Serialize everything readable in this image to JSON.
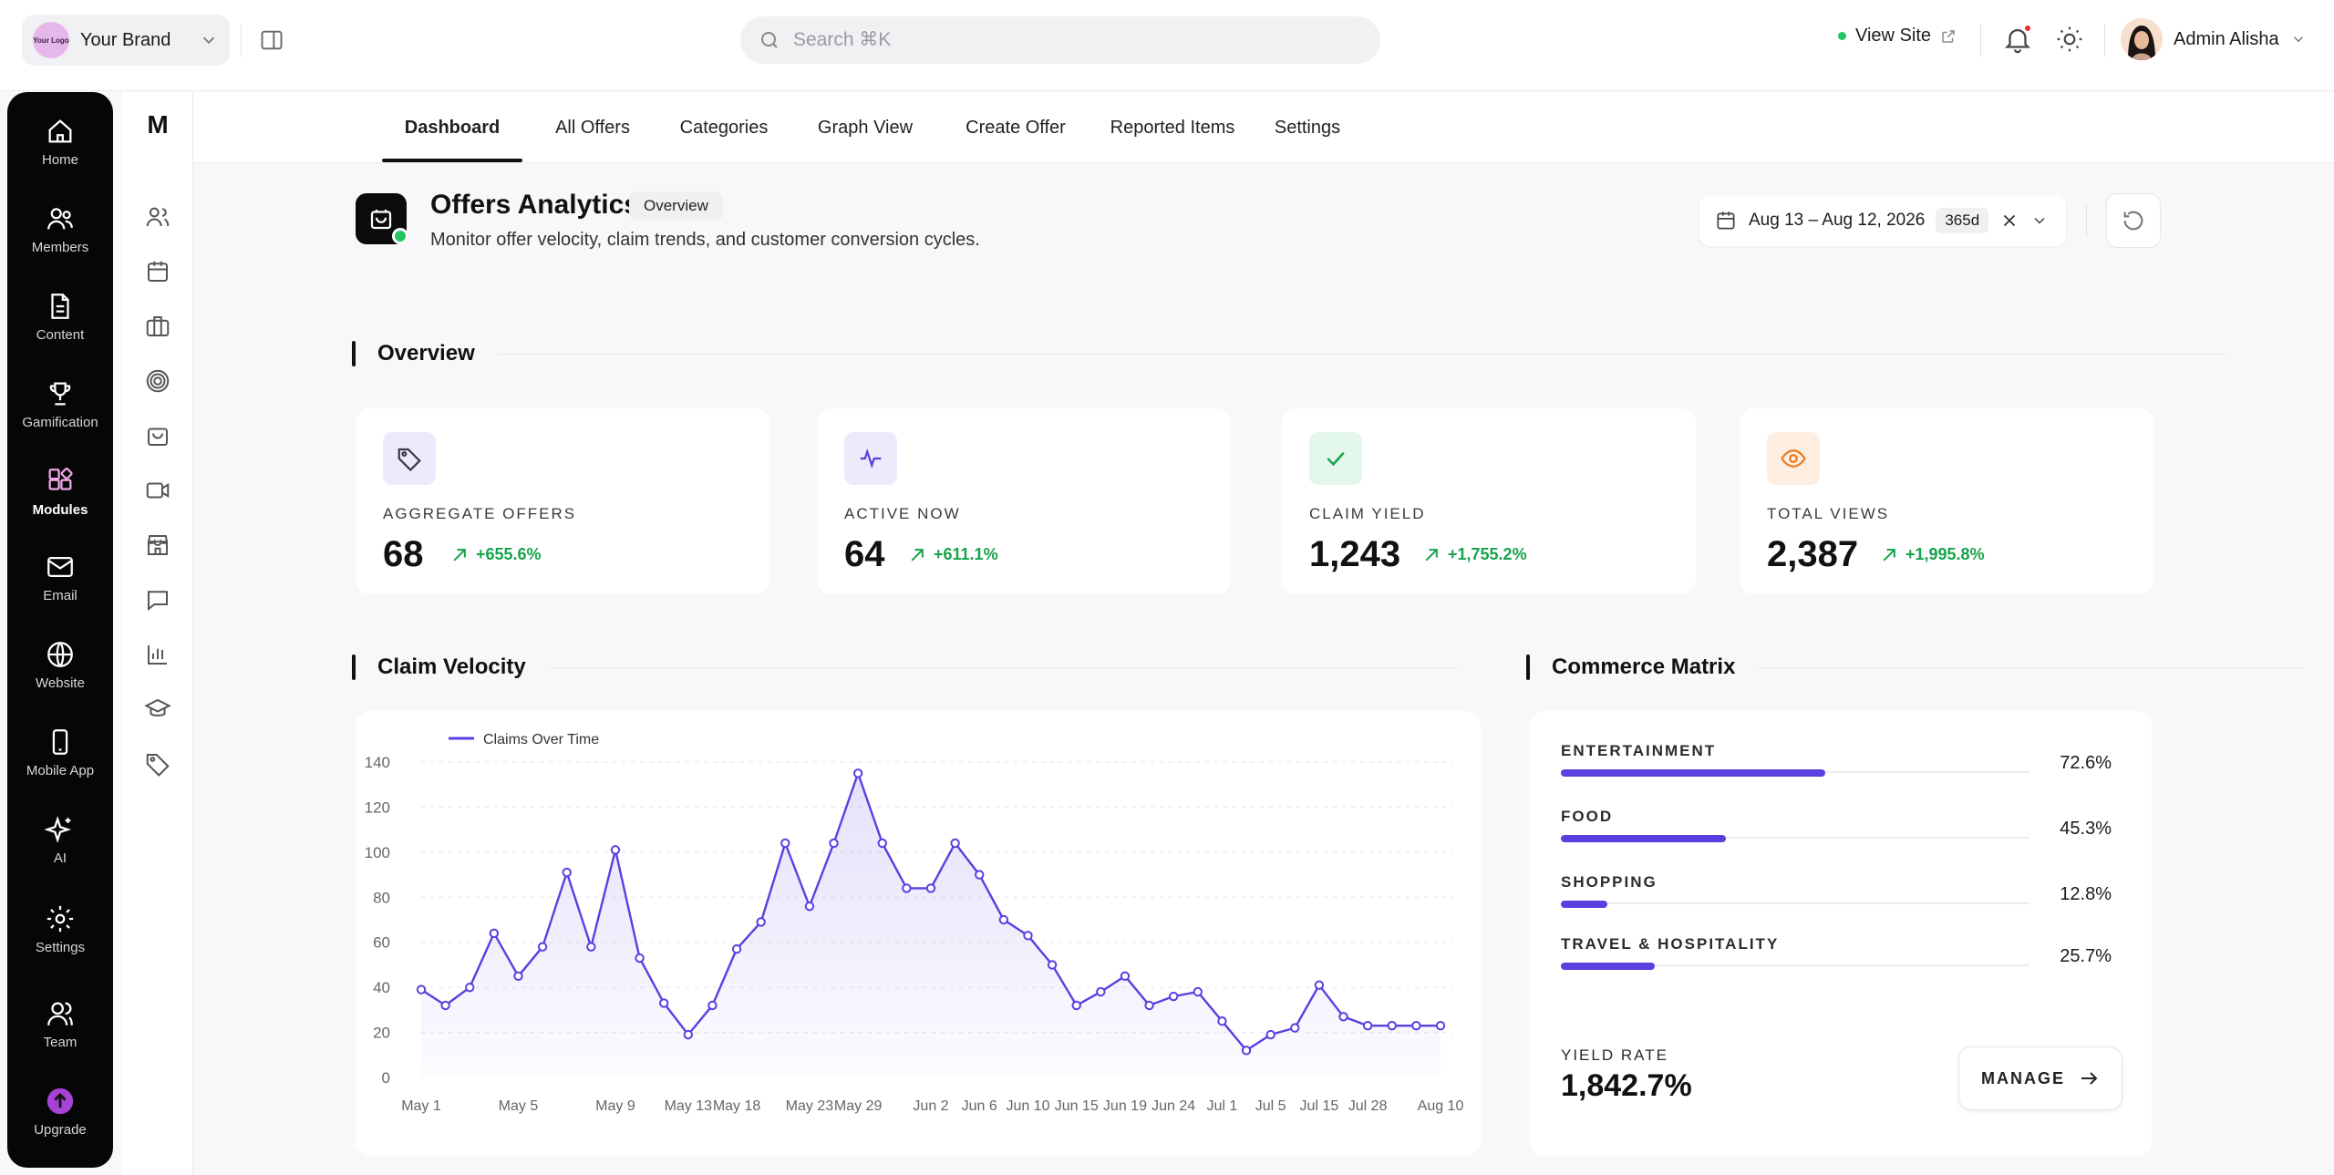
{
  "brand": {
    "logo_text": "Your Logo",
    "name": "Your Brand"
  },
  "search": {
    "placeholder": "Search ⌘K"
  },
  "header": {
    "view_site": "View Site",
    "user_name": "Admin Alisha"
  },
  "rail": [
    {
      "label": "Home",
      "icon": "home-icon"
    },
    {
      "label": "Members",
      "icon": "members-icon"
    },
    {
      "label": "Content",
      "icon": "document-icon"
    },
    {
      "label": "Gamification",
      "icon": "trophy-icon"
    },
    {
      "label": "Modules",
      "icon": "modules-icon",
      "active": true
    },
    {
      "label": "Email",
      "icon": "mail-icon"
    },
    {
      "label": "Website",
      "icon": "globe-icon"
    },
    {
      "label": "Mobile App",
      "icon": "phone-icon"
    },
    {
      "label": "AI",
      "icon": "sparkles-icon"
    },
    {
      "label": "Settings",
      "icon": "gear-icon"
    },
    {
      "label": "Team",
      "icon": "team-icon"
    },
    {
      "label": "Upgrade",
      "icon": "upgrade-icon"
    }
  ],
  "subnav": {
    "logo": "M",
    "icons": [
      "users-icon",
      "calendar-icon",
      "briefcase-icon",
      "target-icon",
      "bag-icon",
      "video-icon",
      "store-icon",
      "chat-icon",
      "bar-chart-icon",
      "graduation-cap-icon",
      "tag-icon"
    ]
  },
  "tabs": [
    "Dashboard",
    "All Offers",
    "Categories",
    "Graph View",
    "Create Offer",
    "Reported Items",
    "Settings"
  ],
  "page": {
    "title": "Offers Analytics",
    "badge": "Overview",
    "subtitle": "Monitor offer velocity, claim trends, and customer conversion cycles.",
    "date_range": "Aug 13 – Aug 12, 2026",
    "date_badge": "365d"
  },
  "sections": {
    "overview": "Overview",
    "velocity": "Claim Velocity",
    "matrix": "Commerce Matrix"
  },
  "kpis": [
    {
      "label": "AGGREGATE OFFERS",
      "value": "68",
      "trend": "+655.6%",
      "icon": "tag-icon",
      "icon_bg": "#ecebfb",
      "icon_color": "#3b3b4a"
    },
    {
      "label": "ACTIVE NOW",
      "value": "64",
      "trend": "+611.1%",
      "icon": "activity-icon",
      "icon_bg": "#ecebfb",
      "icon_color": "#5b3fe0"
    },
    {
      "label": "CLAIM YIELD",
      "value": "1,243",
      "trend": "+1,755.2%",
      "icon": "check-icon",
      "icon_bg": "#e3f7ea",
      "icon_color": "#16a34a"
    },
    {
      "label": "TOTAL VIEWS",
      "value": "2,387",
      "trend": "+1,995.8%",
      "icon": "eye-icon",
      "icon_bg": "#fdeee1",
      "icon_color": "#ea7a1c"
    }
  ],
  "matrix": {
    "rows": [
      {
        "label": "ENTERTAINMENT",
        "pct_text": "72.6%",
        "value": 72.6
      },
      {
        "label": "FOOD",
        "pct_text": "45.3%",
        "value": 45.3
      },
      {
        "label": "SHOPPING",
        "pct_text": "12.8%",
        "value": 12.8
      },
      {
        "label": "TRAVEL & HOSPITALITY",
        "pct_text": "25.7%",
        "value": 25.7
      }
    ],
    "yield_label": "YIELD RATE",
    "yield_value": "1,842.7%",
    "manage_label": "MANAGE"
  },
  "colors": {
    "accent": "#5b3fe0",
    "positive": "#16a34a"
  },
  "chart_data": {
    "type": "line",
    "series": [
      {
        "name": "Claims Over Time",
        "x": [
          "May 1",
          "May 2",
          "May 3",
          "May 4",
          "May 5",
          "May 6",
          "May 7",
          "May 8",
          "May 9",
          "May 10",
          "May 11",
          "May 13",
          "May 15",
          "May 18",
          "May 20",
          "May 21",
          "May 23",
          "May 26",
          "May 29",
          "May 30",
          "May 31",
          "Jun 2",
          "Jun 4",
          "Jun 6",
          "Jun 8",
          "Jun 10",
          "Jun 12",
          "Jun 15",
          "Jun 17",
          "Jun 19",
          "Jun 21",
          "Jun 24",
          "Jun 27",
          "Jul 1",
          "Jul 3",
          "Jul 5",
          "Jul 10",
          "Jul 15",
          "Jul 20",
          "Jul 28",
          "Aug 1",
          "Aug 4",
          "Aug 10"
        ],
        "y": [
          39,
          32,
          40,
          64,
          45,
          58,
          91,
          58,
          101,
          53,
          33,
          19,
          32,
          57,
          69,
          104,
          76,
          104,
          135,
          104,
          84,
          84,
          104,
          90,
          70,
          63,
          50,
          32,
          38,
          45,
          32,
          36,
          38,
          25,
          12,
          19,
          22,
          41,
          27,
          23,
          23,
          23,
          23
        ]
      }
    ],
    "x_ticks": [
      "May 1",
      "May 5",
      "May 9",
      "May 13",
      "May 18",
      "May 23",
      "May 29",
      "Jun 2",
      "Jun 6",
      "Jun 10",
      "Jun 15",
      "Jun 19",
      "Jun 24",
      "Jul 1",
      "Jul 5",
      "Jul 15",
      "Jul 28",
      "Aug 10"
    ],
    "y_ticks": [
      0,
      20,
      40,
      60,
      80,
      100,
      120,
      140
    ],
    "ylim": [
      0,
      140
    ],
    "legend": "top-left",
    "grid": true
  }
}
